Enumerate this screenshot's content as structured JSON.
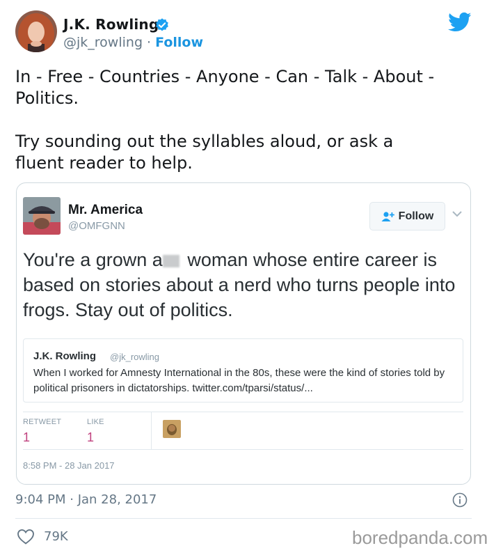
{
  "tweet": {
    "author_name": "J.K. Rowling",
    "author_handle": "@jk_rowling",
    "separator": " · ",
    "follow_label": "Follow",
    "text": "In - Free - Countries - Anyone - Can - Talk - About -\nPolitics.\n\nTry sounding out the syllables aloud, or ask a\nfluent reader to help.",
    "timestamp": "9:04 PM · Jan 28, 2017",
    "like_count": "79K",
    "icons": {
      "verified": "verified-badge-icon",
      "brand": "twitter-bird-icon",
      "info": "info-icon",
      "like": "heart-icon"
    }
  },
  "quoted_tweet": {
    "author_name": "Mr. America",
    "author_handle": "@OMFGNN",
    "follow_label": "Follow",
    "text_before_redaction": "You're a grown a",
    "text_after_redaction": " woman whose entire career is based on stories about a nerd who turns people into frogs. Stay out of politics.",
    "inner_quote": {
      "author_name": "J.K. Rowling",
      "author_handle": "@jk_rowling",
      "text": "When I worked for Amnesty International in the 80s, these were the kind of stories told by political prisoners in dictatorships. twitter.com/tparsi/status/..."
    },
    "stats": {
      "retweet_label": "RETWEET",
      "retweet_count": "1",
      "like_label": "LIKE",
      "like_count": "1"
    },
    "timestamp": "8:58 PM - 28 Jan 2017"
  },
  "watermark": "boredpanda.com",
  "colors": {
    "twitter_blue": "#1da1f2",
    "follow_link": "#1b95e0",
    "secondary_text": "#657786",
    "stat_count": "#c0427f",
    "border": "#e1e8ed"
  }
}
